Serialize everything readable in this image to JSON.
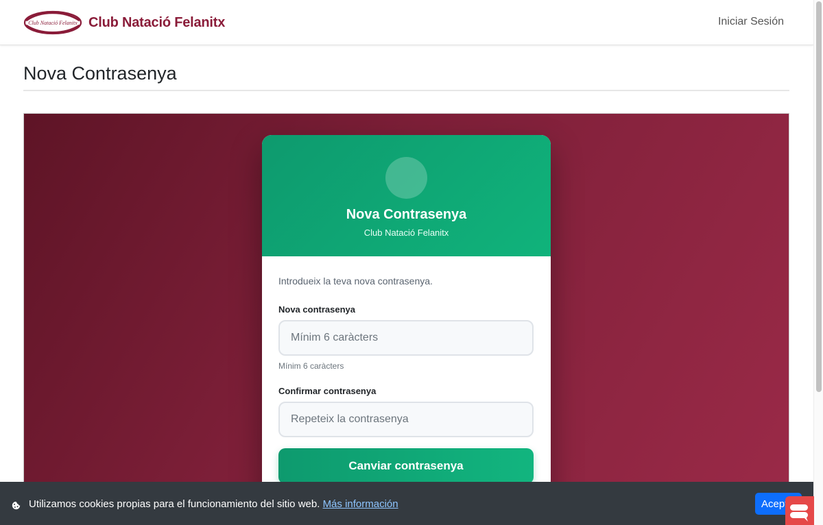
{
  "navbar": {
    "logo_text": "Club Natació Felanitx",
    "brand": "Club Natació Felanitx",
    "login": "Iniciar Sesión"
  },
  "page": {
    "title": "Nova Contrasenya"
  },
  "card": {
    "title": "Nova Contrasenya",
    "subtitle": "Club Natació Felanitx",
    "intro": "Introdueix la teva nova contrasenya.",
    "password_label": "Nova contrasenya",
    "password_placeholder": "Mínim 6 caràcters",
    "password_help": "Mínim 6 caràcters",
    "confirm_label": "Confirmar contrasenya",
    "confirm_placeholder": "Repeteix la contrasenya",
    "submit": "Canviar contrasenya"
  },
  "cookie_bar": {
    "text": "Utilizamos cookies propias para el funcionamiento del sitio web.",
    "link": "Más información",
    "accept": "Aceptar"
  },
  "colors": {
    "brand": "#8a1c39",
    "hero_start": "#5e1426",
    "hero_end": "#9b2a48",
    "card_header": "#10a474",
    "cookie_bg": "#343a40",
    "accept_button": "#0d6efd"
  },
  "icons": [
    "club-logo-icon",
    "cookie-icon",
    "chat-widget-icon"
  ]
}
